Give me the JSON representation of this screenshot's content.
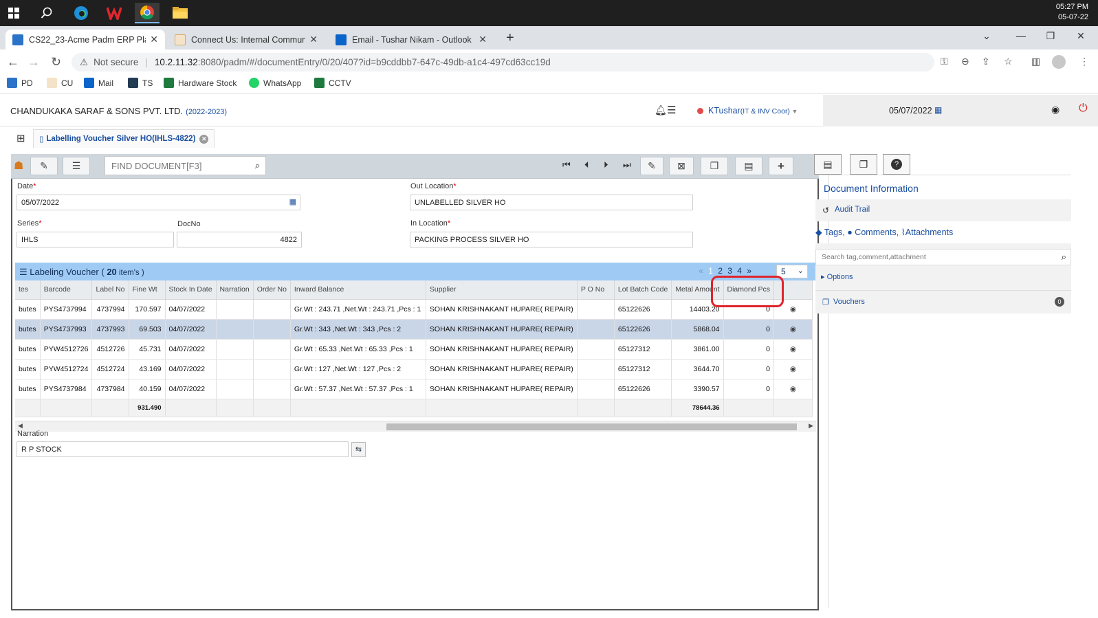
{
  "taskbar": {
    "time": "05:27 PM",
    "date": "05-07-22"
  },
  "browser": {
    "tabs": [
      {
        "title": "CS22_23-Acme Padm ERP Platform",
        "active": true
      },
      {
        "title": "Connect Us: Internal Communicati",
        "active": false
      },
      {
        "title": "Email - Tushar Nikam - Outlook",
        "active": false
      }
    ],
    "new_tab": "+",
    "security_label": "Not secure",
    "url_host": "10.2.11.32",
    "url_path": ":8080/padm/#/documentEntry/0/20/407?id=b9cddbb7-647c-49db-a1c4-497cd63cc19d",
    "bookmarks": [
      "PD",
      "CU",
      "Mail",
      "TS",
      "Hardware Stock",
      "WhatsApp",
      "CCTV"
    ]
  },
  "app": {
    "company": "CHANDUKAKA SARAF & SONS PVT. LTD.",
    "year": "(2022-2023)",
    "user": "KTushar",
    "user_role": "(IT & INV Coor)",
    "header_date": "05/07/2022",
    "doc_tab": "Labelling Voucher Silver HO(IHLS-4822)",
    "find_placeholder": "FIND DOCUMENT[F3]"
  },
  "form": {
    "date_label": "Date",
    "date_value": "05/07/2022",
    "out_location_label": "Out Location",
    "out_location_value": "UNLABELLED SILVER HO",
    "series_label": "Series",
    "series_value": "IHLS",
    "docno_label": "DocNo",
    "docno_value": "4822",
    "in_location_label": "In Location",
    "in_location_value": "PACKING PROCESS SILVER HO",
    "narration_label": "Narration",
    "narration_value": "R P STOCK"
  },
  "grid": {
    "title": "Labeling Voucher ( ",
    "count": "20",
    "items_suffix": " item's )",
    "pager": [
      "«",
      "1",
      "2",
      "3",
      "4",
      "»"
    ],
    "page_size": "5",
    "columns": [
      "tes",
      "Barcode",
      "Label No",
      "Fine Wt",
      "Stock In Date",
      "Narration",
      "Order No",
      "Inward Balance",
      "Supplier",
      "P O No",
      "Lot Batch Code",
      "Metal Amount",
      "Diamond Pcs",
      ""
    ],
    "rows": [
      [
        "butes",
        "PYS4737994",
        "4737994",
        "170.597",
        "04/07/2022",
        "",
        "",
        "Gr.Wt : 243.71 ,Net.Wt : 243.71 ,Pcs : 1",
        "SOHAN KRISHNAKANT HUPARE( REPAIR)",
        "",
        "65122626",
        "14403.20",
        "0"
      ],
      [
        "butes",
        "PYS4737993",
        "4737993",
        "69.503",
        "04/07/2022",
        "",
        "",
        "Gr.Wt : 343 ,Net.Wt : 343 ,Pcs : 2",
        "SOHAN KRISHNAKANT HUPARE( REPAIR)",
        "",
        "65122626",
        "5868.04",
        "0"
      ],
      [
        "butes",
        "PYW4512726",
        "4512726",
        "45.731",
        "04/07/2022",
        "",
        "",
        "Gr.Wt : 65.33 ,Net.Wt : 65.33 ,Pcs : 1",
        "SOHAN KRISHNAKANT HUPARE( REPAIR)",
        "",
        "65127312",
        "3861.00",
        "0"
      ],
      [
        "butes",
        "PYW4512724",
        "4512724",
        "43.169",
        "04/07/2022",
        "",
        "",
        "Gr.Wt : 127 ,Net.Wt : 127 ,Pcs : 2",
        "SOHAN KRISHNAKANT HUPARE( REPAIR)",
        "",
        "65127312",
        "3644.70",
        "0"
      ],
      [
        "butes",
        "PYS4737984",
        "4737984",
        "40.159",
        "04/07/2022",
        "",
        "",
        "Gr.Wt : 57.37 ,Net.Wt : 57.37 ,Pcs : 1",
        "SOHAN KRISHNAKANT HUPARE( REPAIR)",
        "",
        "65122626",
        "3390.57",
        "0"
      ]
    ],
    "selected_row": 1,
    "total_fine_wt": "931.490",
    "total_metal_amount": "78644.36"
  },
  "right_panel": {
    "title": "Document Information",
    "audit_trail": "Audit Trail",
    "tags": "Tags,",
    "comments": "Comments,",
    "attachments": "Attachments",
    "search_placeholder": "Search tag,comment,attachment",
    "options": "Options",
    "vouchers": "Vouchers",
    "vouchers_count": "0"
  },
  "colors": {
    "accent": "#1a4fa0",
    "grid_header": "#9fcaf3",
    "annotation": "#e0232c"
  }
}
